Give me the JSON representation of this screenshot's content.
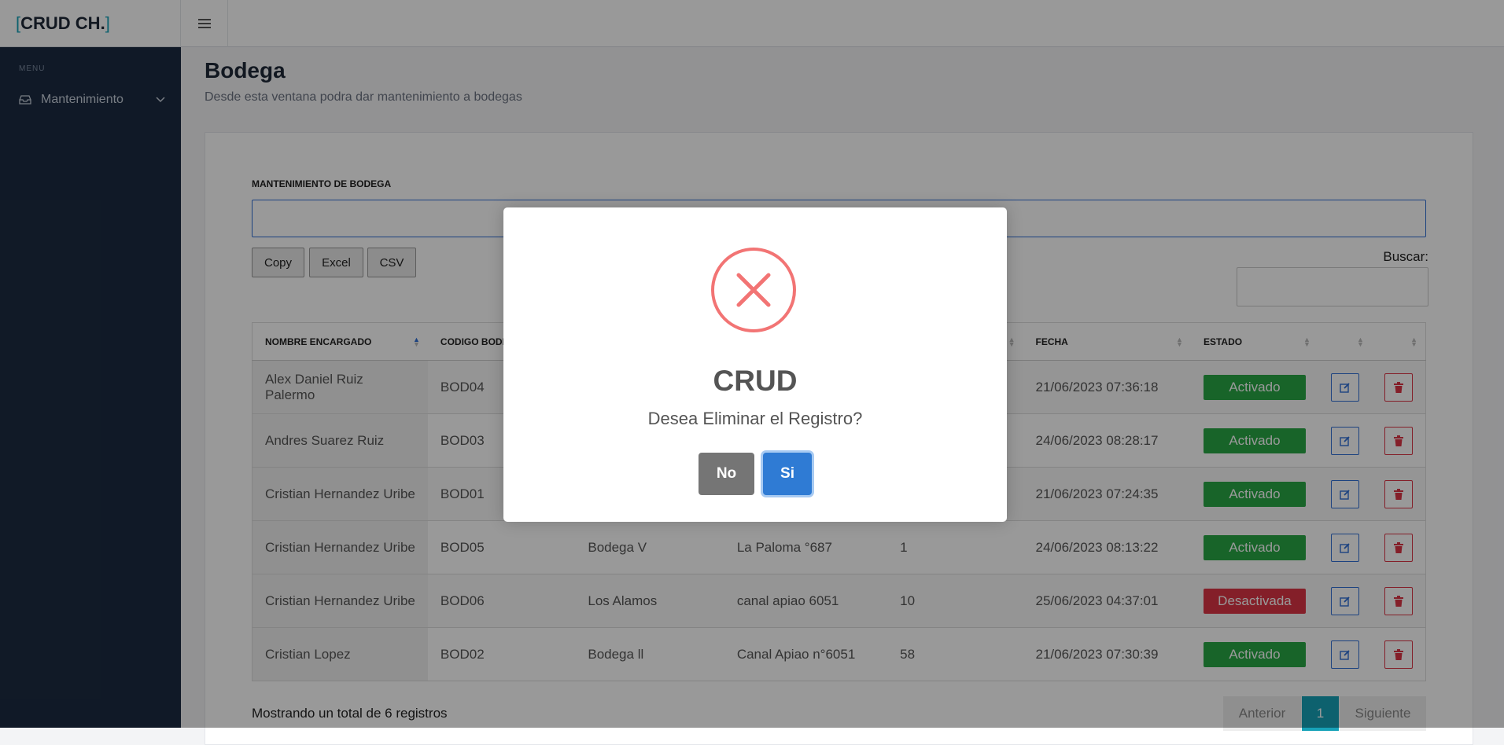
{
  "app": {
    "brand_open": "[",
    "brand_name": "CRUD CH.",
    "brand_close": "]"
  },
  "sidebar": {
    "header": "MENU",
    "items": [
      {
        "label": "Mantenimiento",
        "icon": "inbox-icon"
      }
    ]
  },
  "page": {
    "title": "Bodega",
    "subtitle": "Desde esta ventana podra dar mantenimiento a bodegas"
  },
  "card": {
    "label": "MANTENIMIENTO DE BODEGA",
    "buttons": [
      "Copy",
      "Excel",
      "CSV"
    ],
    "search_label": "Buscar:"
  },
  "table": {
    "headers": [
      "NOMBRE ENCARGADO",
      "CODIGO BODEGA",
      "",
      "",
      "",
      "FECHA",
      "ESTADO",
      "",
      ""
    ],
    "rows": [
      {
        "nombre": "Alex Daniel Ruiz Palermo",
        "codigo": "BOD04",
        "bodega": "",
        "direccion": "",
        "cantidad": "",
        "fecha": "21/06/2023 07:36:18",
        "estado": "Activado"
      },
      {
        "nombre": "Andres Suarez Ruiz",
        "codigo": "BOD03",
        "bodega": "",
        "direccion": "",
        "cantidad": "",
        "fecha": "24/06/2023 08:28:17",
        "estado": "Activado"
      },
      {
        "nombre": "Cristian Hernandez Uribe",
        "codigo": "BOD01",
        "bodega": "",
        "direccion": "",
        "cantidad": "",
        "fecha": "21/06/2023 07:24:35",
        "estado": "Activado"
      },
      {
        "nombre": "Cristian Hernandez Uribe",
        "codigo": "BOD05",
        "bodega": "Bodega V",
        "direccion": "La Paloma °687",
        "cantidad": "1",
        "fecha": "24/06/2023 08:13:22",
        "estado": "Activado"
      },
      {
        "nombre": "Cristian Hernandez Uribe",
        "codigo": "BOD06",
        "bodega": "Los Alamos",
        "direccion": "canal apiao 6051",
        "cantidad": "10",
        "fecha": "25/06/2023 04:37:01",
        "estado": "Desactivada"
      },
      {
        "nombre": "Cristian Lopez",
        "codigo": "BOD02",
        "bodega": "Bodega ll",
        "direccion": "Canal Apiao n°6051",
        "cantidad": "58",
        "fecha": "21/06/2023 07:30:39",
        "estado": "Activado"
      }
    ]
  },
  "footer": {
    "info": "Mostrando un total de 6 registros",
    "prev": "Anterior",
    "page": "1",
    "next": "Siguiente"
  },
  "modal": {
    "title": "CRUD",
    "text": "Desea Eliminar el Registro?",
    "no": "No",
    "si": "Si"
  },
  "colors": {
    "sidebar": "#1c2b41",
    "accent": "#17a2b8",
    "activado": "#28a745",
    "desactivada": "#dc3545",
    "confirm": "#2f7bd4",
    "cancel": "#757575",
    "error": "#f27474"
  }
}
